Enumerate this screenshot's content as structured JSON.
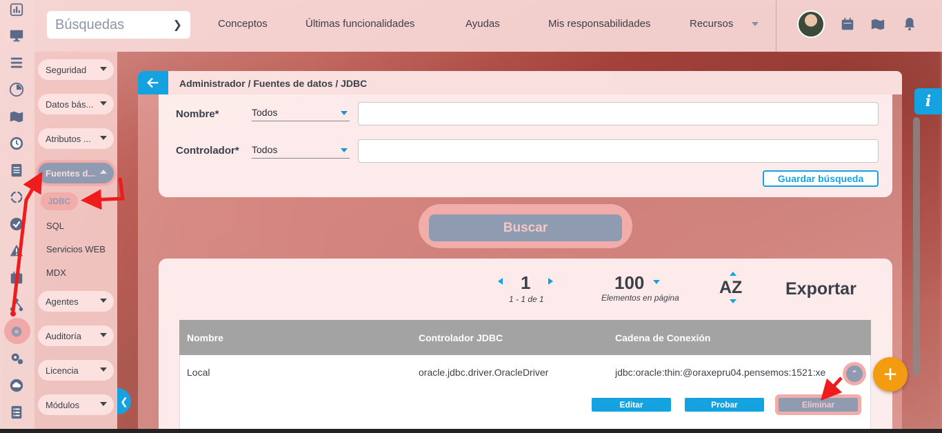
{
  "topbar": {
    "search_placeholder": "Búsquedas",
    "nav": [
      "Conceptos",
      "Últimas funcionalidades",
      "Ayudas",
      "Mis responsabilidades",
      "Recursos"
    ]
  },
  "rail_icons": [
    "chart-icon",
    "monitor-icon",
    "list-icon",
    "pie-icon",
    "map-icon",
    "clock-icon",
    "document-icon",
    "cycle-icon",
    "check-icon",
    "warning-icon",
    "calendar-icon",
    "network-icon",
    "gear-icon",
    "gears-icon",
    "cloud-icon",
    "checklist-icon"
  ],
  "submenu": {
    "items": [
      {
        "label": "Seguridad"
      },
      {
        "label": "Datos bás..."
      },
      {
        "label": "Atributos ..."
      },
      {
        "label": "Fuentes d..."
      },
      {
        "label": "Agentes"
      },
      {
        "label": "Auditoría"
      },
      {
        "label": "Licencia"
      },
      {
        "label": "Módulos"
      }
    ],
    "children": [
      "JDBC",
      "SQL",
      "Servicios WEB",
      "MDX"
    ]
  },
  "breadcrumb": "Administrador / Fuentes de datos / JDBC",
  "filters": {
    "name_label": "Nombre*",
    "name_op": "Todos",
    "controller_label": "Controlador*",
    "controller_op": "Todos",
    "save_label": "Guardar búsqueda"
  },
  "search_button": "Buscar",
  "pager": {
    "page": "1",
    "range": "1 - 1 de 1",
    "page_size": "100",
    "page_size_label": "Elementos en página",
    "sort": "AZ",
    "export": "Exportar"
  },
  "table": {
    "headers": [
      "Nombre",
      "Controlador JDBC",
      "Cadena de Conexión"
    ],
    "rows": [
      {
        "name": "Local",
        "driver": "oracle.jdbc.driver.OracleDriver",
        "connection": "jdbc:oracle:thin:@oraxepru04.pensemos:1521:xe"
      }
    ],
    "actions": [
      "Editar",
      "Probar",
      "Eliminar"
    ]
  },
  "info_label": "i",
  "fab_label": "+",
  "colors": {
    "accent": "#14a3e0",
    "highlight": "#f2adab",
    "disabled": "#8f9bb0",
    "annotation": "#ee1c1c",
    "fab": "#f39c12"
  }
}
